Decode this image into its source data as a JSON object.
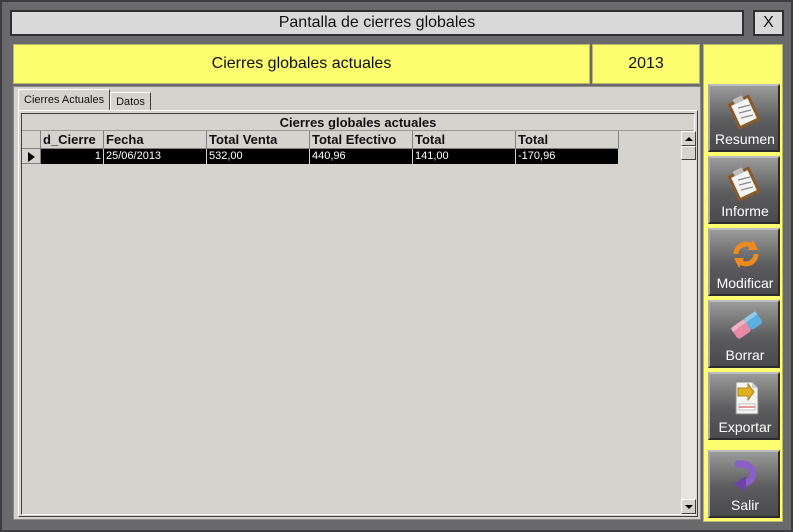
{
  "window": {
    "title": "Pantalla de cierres globales",
    "close_label": "X"
  },
  "header": {
    "title": "Cierres globales actuales",
    "year": "2013"
  },
  "tabs": [
    {
      "label": "Cierres Actuales",
      "active": true
    },
    {
      "label": "Datos",
      "active": false
    }
  ],
  "grid": {
    "caption": "Cierres globales actuales",
    "columns": [
      "d_Cierre",
      "Fecha",
      "Total Venta",
      "Total Efectivo",
      "Total",
      "Total"
    ],
    "rows": [
      {
        "id": "1",
        "fecha": "25/06/2013",
        "total_venta": "532,00",
        "total_efectivo": "440,96",
        "total_1": "141,00",
        "total_2": "-170,96"
      }
    ]
  },
  "sidebar": {
    "buttons": [
      {
        "label": "Resumen",
        "icon": "clipboard-icon"
      },
      {
        "label": "Informe",
        "icon": "clipboard-icon"
      },
      {
        "label": "Modificar",
        "icon": "refresh-icon"
      },
      {
        "label": "Borrar",
        "icon": "eraser-icon"
      },
      {
        "label": "Exportar",
        "icon": "excel-export-icon"
      },
      {
        "label": "Salir",
        "icon": "exit-arrow-icon"
      }
    ]
  },
  "colors": {
    "yellow_panel": "#fdfd70",
    "window_bg": "#6a6a6c",
    "grid_bg": "#d6d3ce",
    "selected_row": "#000000"
  }
}
